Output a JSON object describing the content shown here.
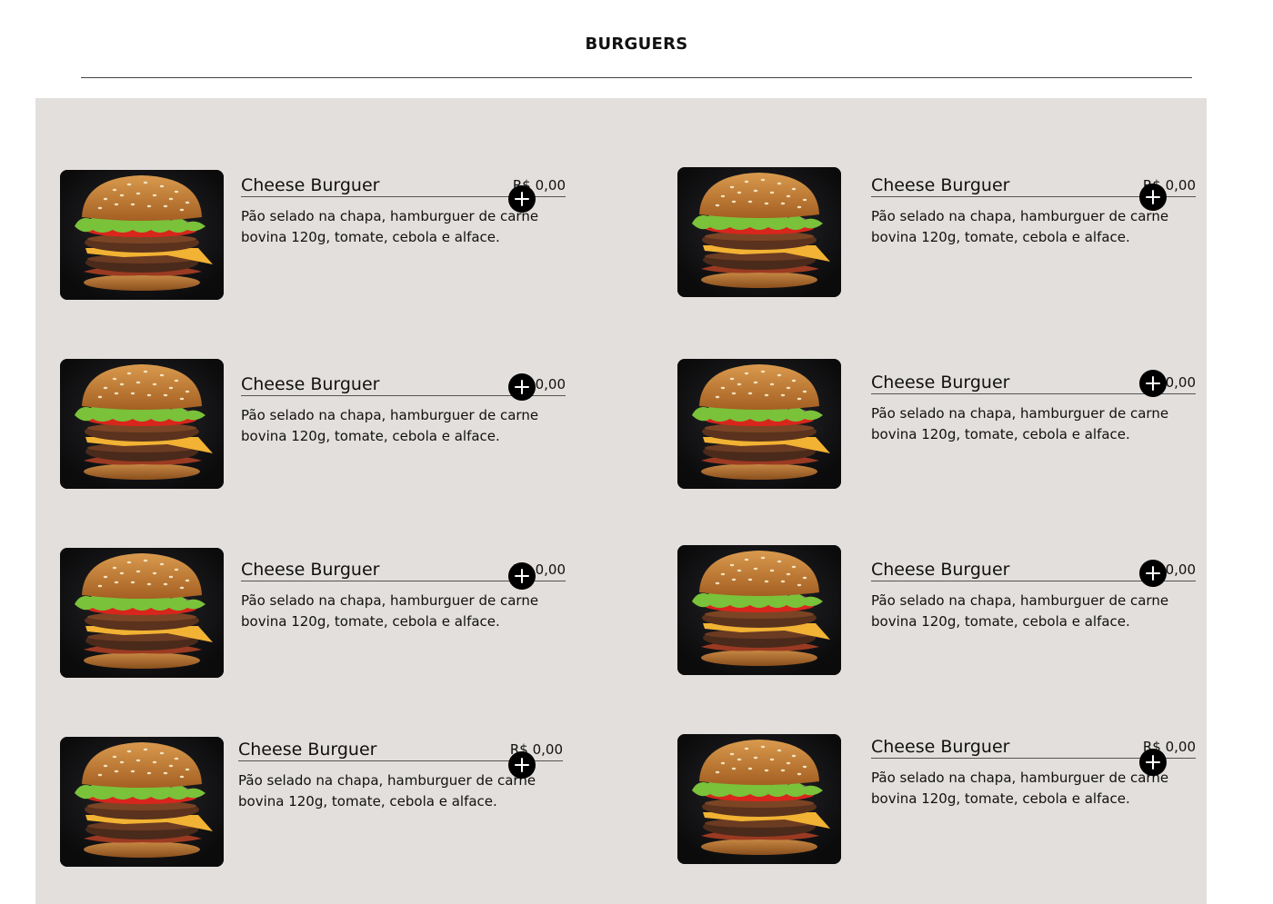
{
  "page": {
    "title": "BURGUERS"
  },
  "colors": {
    "panel_background": "#e2dfdc",
    "button": "#000000",
    "text": "#111111"
  },
  "items": [
    {
      "name": "Cheese Burguer",
      "price": "R$ 0,00",
      "description": "Pão selado na chapa, hamburguer de carne bovina 120g, tomate, cebola e alface.",
      "image_icon": "burger-photo",
      "action_icon": "plus-icon"
    },
    {
      "name": "Cheese Burguer",
      "price": "R$ 0,00",
      "description": "Pão selado na chapa, hamburguer de carne bovina 120g, tomate, cebola e alface.",
      "image_icon": "burger-photo",
      "action_icon": "plus-icon"
    },
    {
      "name": "Cheese Burguer",
      "price": "R$ 0,00",
      "description": "Pão selado na chapa, hamburguer de carne bovina 120g, tomate, cebola e alface.",
      "image_icon": "burger-photo",
      "action_icon": "plus-icon"
    },
    {
      "name": "Cheese Burguer",
      "price": "R$ 0,00",
      "description": "Pão selado na chapa, hamburguer de carne bovina 120g, tomate, cebola e alface.",
      "image_icon": "burger-photo",
      "action_icon": "plus-icon"
    },
    {
      "name": "Cheese Burguer",
      "price": "R$ 0,00",
      "description": "Pão selado na chapa, hamburguer de carne bovina 120g, tomate, cebola e alface.",
      "image_icon": "burger-photo",
      "action_icon": "plus-icon"
    },
    {
      "name": "Cheese Burguer",
      "price": "R$ 0,00",
      "description": "Pão selado na chapa, hamburguer de carne bovina 120g, tomate, cebola e alface.",
      "image_icon": "burger-photo",
      "action_icon": "plus-icon"
    },
    {
      "name": "Cheese Burguer",
      "price": "R$ 0,00",
      "description": "Pão selado na chapa, hamburguer de carne bovina 120g, tomate, cebola e alface.",
      "image_icon": "burger-photo",
      "action_icon": "plus-icon"
    },
    {
      "name": "Cheese Burguer",
      "price": "R$ 0,00",
      "description": "Pão selado na chapa, hamburguer de carne bovina 120g, tomate, cebola e alface.",
      "image_icon": "burger-photo",
      "action_icon": "plus-icon"
    }
  ]
}
